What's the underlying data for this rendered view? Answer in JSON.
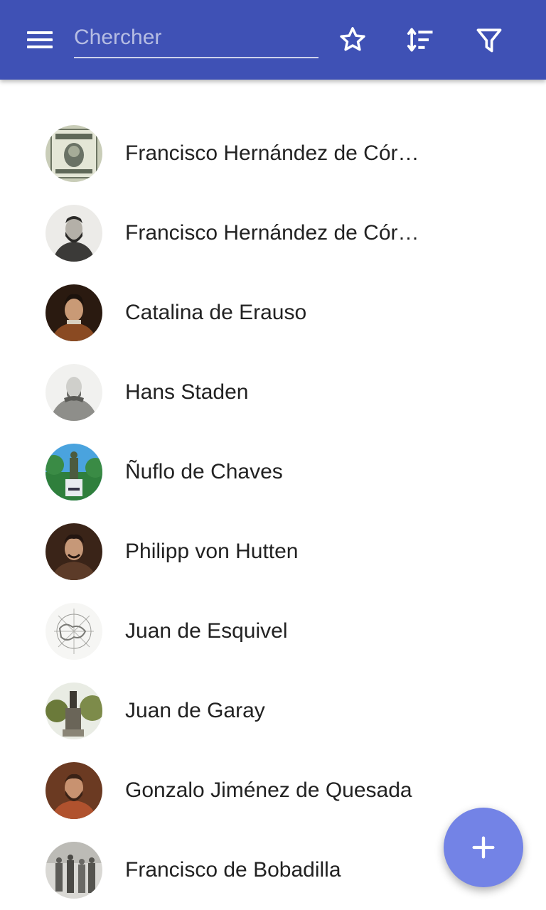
{
  "toolbar": {
    "search_placeholder": "Chercher",
    "menu_icon": "menu-icon",
    "favorites_icon": "star-outline-icon",
    "sort_icon": "sort-icon",
    "filter_icon": "filter-icon",
    "color": "#3f51b5"
  },
  "people": [
    {
      "name": "Francisco Hernández de Córdoba",
      "avatar": "stamp-portrait"
    },
    {
      "name": "Francisco Hernández de Córdoba",
      "avatar": "engraved-portrait"
    },
    {
      "name": "Catalina de Erauso",
      "avatar": "painted-portrait"
    },
    {
      "name": "Hans Staden",
      "avatar": "engraved-portrait"
    },
    {
      "name": "Ñuflo de Chaves",
      "avatar": "statue-photo"
    },
    {
      "name": "Philipp von Hutten",
      "avatar": "painted-portrait"
    },
    {
      "name": "Juan de Esquivel",
      "avatar": "map-sketch"
    },
    {
      "name": "Juan de Garay",
      "avatar": "monument-photo"
    },
    {
      "name": "Gonzalo Jiménez de Quesada",
      "avatar": "painted-portrait"
    },
    {
      "name": "Francisco de Bobadilla",
      "avatar": "engraving-scene"
    }
  ],
  "fab": {
    "icon": "plus-icon",
    "color": "#7383e6"
  }
}
